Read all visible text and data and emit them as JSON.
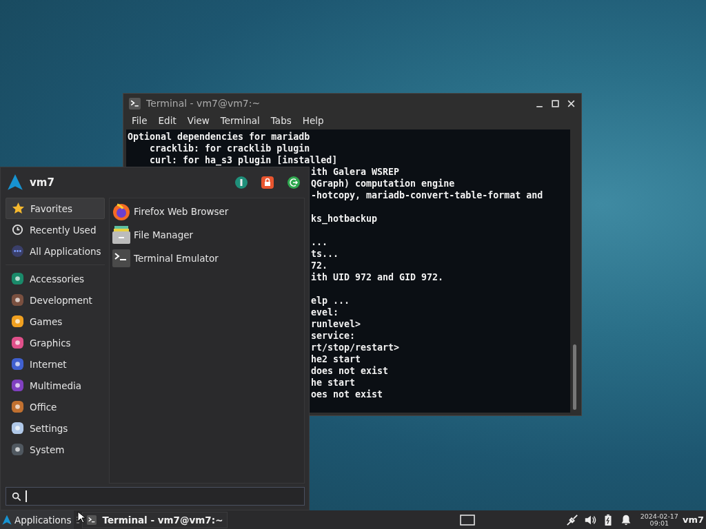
{
  "terminal": {
    "title": "Terminal - vm7@vm7:~",
    "menu": [
      "File",
      "Edit",
      "View",
      "Terminal",
      "Tabs",
      "Help"
    ],
    "lines": [
      {
        "kind": "full",
        "text": "Optional dependencies for mariadb"
      },
      {
        "kind": "full",
        "text": "    cracklib: for cracklib plugin"
      },
      {
        "kind": "full",
        "text": "    curl: for ha_s3 plugin [installed]"
      },
      {
        "kind": "clipped",
        "text": "ith Galera WSREP"
      },
      {
        "kind": "clipped",
        "text": "QGraph) computation engine"
      },
      {
        "kind": "clipped",
        "text": "-hotcopy, mariadb-convert-table-format and"
      },
      {
        "kind": "blank"
      },
      {
        "kind": "clipped",
        "text": "ks_hotbackup"
      },
      {
        "kind": "blank"
      },
      {
        "kind": "clipped",
        "text": "..."
      },
      {
        "kind": "clipped",
        "text": "ts..."
      },
      {
        "kind": "clipped",
        "text": "72."
      },
      {
        "kind": "clipped",
        "text": "ith UID 972 and GID 972."
      },
      {
        "kind": "blank"
      },
      {
        "kind": "clipped",
        "text": "elp ..."
      },
      {
        "kind": "clipped",
        "text": "evel:"
      },
      {
        "kind": "clipped",
        "text": "runlevel>"
      },
      {
        "kind": "clipped",
        "text": "service:"
      },
      {
        "kind": "clipped",
        "text": "rt/stop/restart>"
      },
      {
        "kind": "clipped",
        "text": "he2 start"
      },
      {
        "kind": "clipped",
        "text": "does not exist"
      },
      {
        "kind": "clipped",
        "text": "he start"
      },
      {
        "kind": "clipped",
        "text": "oes not exist"
      }
    ]
  },
  "menu": {
    "user": "vm7",
    "views": [
      {
        "label": "Favorites",
        "selected": true
      },
      {
        "label": "Recently Used",
        "selected": false
      },
      {
        "label": "All Applications",
        "selected": false
      }
    ],
    "categories": [
      {
        "label": "Accessories",
        "selected": false
      },
      {
        "label": "Development",
        "selected": false
      },
      {
        "label": "Games",
        "selected": false
      },
      {
        "label": "Graphics",
        "selected": false
      },
      {
        "label": "Internet",
        "selected": false
      },
      {
        "label": "Multimedia",
        "selected": false
      },
      {
        "label": "Office",
        "selected": false
      },
      {
        "label": "Settings",
        "selected": false
      },
      {
        "label": "System",
        "selected": false
      }
    ],
    "apps": [
      "Firefox Web Browser",
      "File Manager",
      "Terminal Emulator"
    ],
    "search": {
      "focused": true
    }
  },
  "taskbar": {
    "apps_button": "Applications",
    "tasks": [
      {
        "label": "Terminal - vm7@vm7:~",
        "selected": false
      }
    ],
    "clock": {
      "date": "2024-02-17",
      "time": "09:01"
    },
    "user": "vm7"
  }
}
